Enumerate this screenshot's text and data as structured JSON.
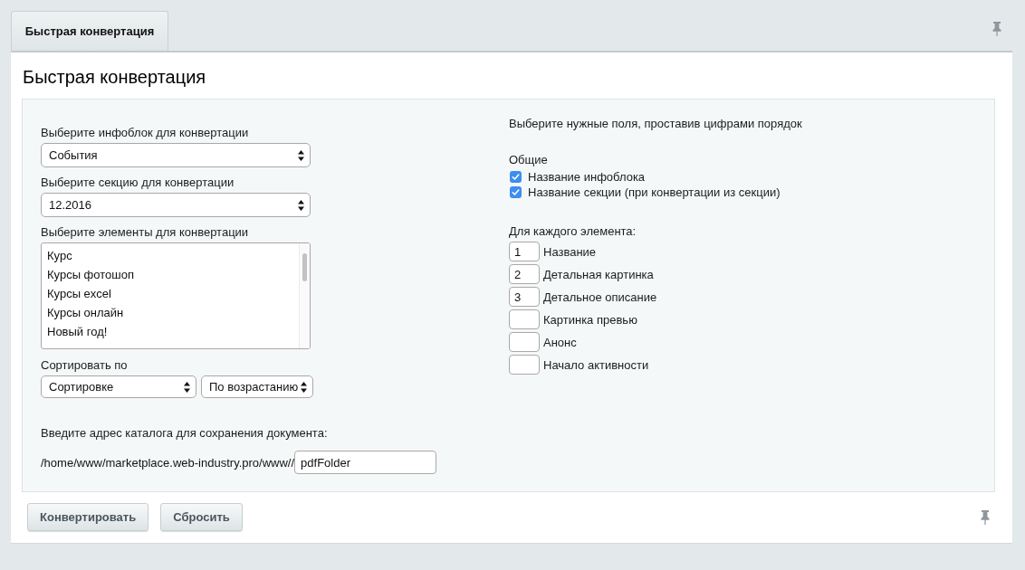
{
  "tabs": [
    {
      "label": "Быстрая конвертация",
      "selected": true
    }
  ],
  "title": "Быстрая конвертация",
  "form": {
    "infoblock": {
      "label": "Выберите инфоблок для конвертации",
      "value": "События"
    },
    "section": {
      "label": "Выберите секцию для конвертации",
      "value": "12.2016"
    },
    "elements": {
      "label": "Выберите элементы для конвертации",
      "items": [
        {
          "label": "Курс",
          "selected": false
        },
        {
          "label": "Курсы фотошоп",
          "selected": false
        },
        {
          "label": "Курсы excel",
          "selected": false
        },
        {
          "label": "Курсы онлайн",
          "selected": false
        },
        {
          "label": "Новый год!",
          "selected": false
        }
      ]
    },
    "sort": {
      "label": "Сортировать по",
      "field": "Сортировке",
      "order": "По возрастанию"
    },
    "folder": {
      "label": "Введите адрес каталога для сохранения документа:",
      "prefix": "/home/www/marketplace.web-industry.pro/www//",
      "value": "pdfFolder"
    }
  },
  "fields": {
    "intro": "Выберите нужные поля, проставив цифрами порядок",
    "common": {
      "heading": "Общие",
      "options": [
        {
          "label": "Название инфоблока",
          "checked": true
        },
        {
          "label": "Название секции (при конвертации из секции)",
          "checked": true
        }
      ]
    },
    "per_element": {
      "heading": "Для каждого элемента:",
      "rows": [
        {
          "label": "Название",
          "order": "1"
        },
        {
          "label": "Детальная картинка",
          "order": "2"
        },
        {
          "label": "Детальное описание",
          "order": "3"
        },
        {
          "label": "Картинка превью"
        },
        {
          "label": "Анонс"
        },
        {
          "label": "Начало активности"
        }
      ]
    }
  },
  "buttons": [
    "Конвертировать",
    "Сбросить"
  ]
}
